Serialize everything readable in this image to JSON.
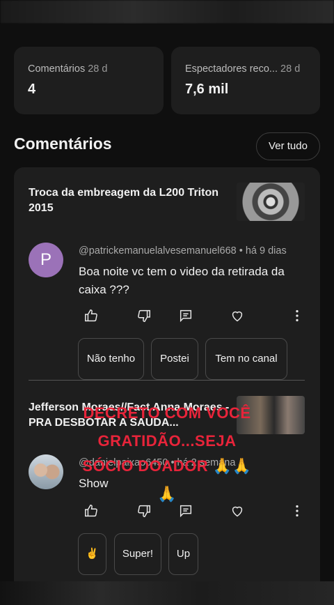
{
  "stats": {
    "comments": {
      "label": "Comentários",
      "period": "28 d",
      "value": "4"
    },
    "viewers": {
      "label": "Espectadores reco...",
      "period": "28 d",
      "value": "7,6 mil"
    }
  },
  "section": {
    "title": "Comentários",
    "see_all": "Ver tudo"
  },
  "comments": [
    {
      "video_title": "Troca da embreagem da L200 Triton 2015",
      "avatar_letter": "P",
      "author": "@patrickemanuelalvesemanuel668",
      "time": "há 9 dias",
      "text": "Boa noite vc tem o video da retirada da caixa ???",
      "replies": [
        "Não tenho",
        "Postei",
        "Tem no canal"
      ]
    },
    {
      "video_title": "Jefferson Moraes//Fact Anna Moraes - PRA DESBOTAR A SAUDA...",
      "author": "@danielpaixao6450",
      "time": "há 2 semana",
      "text": "Show",
      "replies": [
        "✌️",
        "Super!",
        "Up"
      ]
    }
  ],
  "overlay": {
    "line1": "DECRETO COM VOCÊ",
    "line2": "GRATIDÃO...SEJA",
    "line3": "SÓCIO DOADOR 🙏🙏",
    "line4": "🙏"
  },
  "icons": [
    "like-icon",
    "dislike-icon",
    "reply-icon",
    "heart-icon",
    "more-vert-icon"
  ],
  "colors": {
    "background": "#0f0f0f",
    "card": "#1e1e1e",
    "avatar": "#9b72b8",
    "overlay_text": "#e8243a"
  }
}
